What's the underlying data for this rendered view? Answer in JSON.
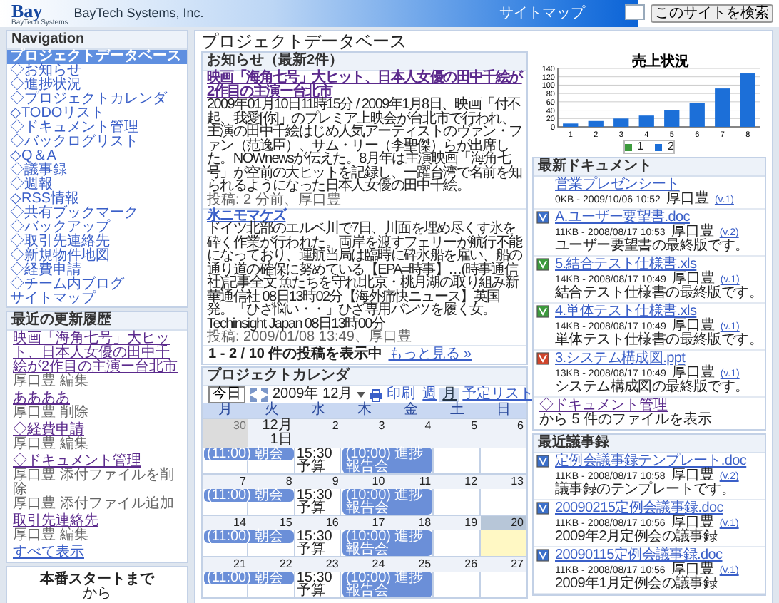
{
  "header": {
    "logo": "Bay",
    "logo_subtitle": "BayTech Systems",
    "company": "BayTech Systems, Inc.",
    "sitemap_link": "サイトマップ",
    "search_button": "このサイトを検索"
  },
  "page_title": "プロジェクトデータベース",
  "sidebar": {
    "navigation": {
      "title": "Navigation",
      "items": [
        {
          "label": "プロジェクトデータベース",
          "selected": true
        },
        {
          "label": "◇お知らせ",
          "selected": false
        },
        {
          "label": "◇進捗状況",
          "selected": false
        },
        {
          "label": "◇プロジェクトカレンダ",
          "selected": false
        },
        {
          "label": "◇TODOリスト",
          "selected": false
        },
        {
          "label": "◇ドキュメント管理",
          "selected": false
        },
        {
          "label": "◇バックログリスト",
          "selected": false
        },
        {
          "label": "◇Q＆A",
          "selected": false
        },
        {
          "label": "◇議事録",
          "selected": false
        },
        {
          "label": "◇週報",
          "selected": false
        },
        {
          "label": "◇RSS情報",
          "selected": false
        },
        {
          "label": "◇共有ブックマーク",
          "selected": false
        },
        {
          "label": "◇バックアップ",
          "selected": false
        },
        {
          "label": "◇取引先連絡先",
          "selected": false
        },
        {
          "label": "◇新規物件地図",
          "selected": false
        },
        {
          "label": "◇経費申請",
          "selected": false
        },
        {
          "label": "◇チーム内ブログ",
          "selected": false
        },
        {
          "label": "サイトマップ",
          "selected": false
        }
      ]
    },
    "recent_updates": {
      "title": "最近の更新履歴",
      "entries": [
        {
          "link": "映画「海角七号」大ヒット、日本人女優の田中千絵が2作目の主演ー台北市",
          "lines": [
            "厚口豊 編集"
          ]
        },
        {
          "link": "ああああ",
          "lines": [
            "厚口豊 削除"
          ]
        },
        {
          "link": "◇経費申請",
          "lines": [
            "厚口豊 編集"
          ]
        },
        {
          "link": "◇ドキュメント管理",
          "lines": [
            "厚口豊 添付ファイルを削除",
            "厚口豊 添付ファイル追加"
          ]
        },
        {
          "link": "取引先連絡先",
          "lines": [
            "厚口豊 編集"
          ]
        }
      ],
      "show_all": "すべて表示"
    },
    "countdown": {
      "title": "本番スタートまで",
      "text": "から"
    }
  },
  "news": {
    "title": "お知らせ（最新2件）",
    "items": [
      {
        "title": "映画「海角七号」大ヒット、日本人女優の田中千絵が2作目の主演ー台北市",
        "body": "2009年01月10日11時15分 / 2009年1月8日、映画「付不起、我愛[你]」のプレミア上映会が台北市で行われ、主演の田中千絵はじめ人気アーティストのヴァン・ファン（范逸臣）、サム・リー（李聖傑）らが出席した。NOWnewsが伝えた。8月年は主演映画「海角七号」が空前の大ヒットを記録し、一躍台湾で名前を知られるようになった日本人女優の田中千絵。",
        "meta": "投稿: 2 分前、厚口豊"
      },
      {
        "title": "氷ニモマケズ",
        "body": "ドイツ北部のエルベ川で7日、川面を埋め尽くす氷を砕く作業が行われた。両岸を渡すフェリーが航行不能になっており、運航当局は臨時に砕氷船を雇い、船の通り道の確保に努めている【EPA=時事】…(時事通信社)記事全文 魚たちを守れ!北京・桃月湖の取り組み新華通信社 08日13時02分【海外痛快ニュース】英国発。「ひざ悩い・・」ひざ専用パンツを履く女。 Techinsight Japan 08日13時00分",
        "meta": "投稿: 2009/01/08 13:49、厚口豊"
      }
    ],
    "footer": "1 - 2 / 10 件の投稿を表示中",
    "more_link": "もっと見る »"
  },
  "calendar": {
    "title": "プロジェクトカレンダ",
    "today_button": "今日",
    "month": "2009年 12月",
    "print": "印刷",
    "views": [
      {
        "label": "週",
        "selected": false
      },
      {
        "label": "月",
        "selected": true
      },
      {
        "label": "予定リスト",
        "selected": false
      }
    ],
    "weekdays": [
      "月",
      "火",
      "水",
      "木",
      "金",
      "土",
      "日"
    ],
    "weeks": [
      {
        "days": [
          {
            "label": "30",
            "other_month": true,
            "today": false
          },
          {
            "label": "12月 1日",
            "other_month": false,
            "today": false
          },
          {
            "label": "2",
            "other_month": false,
            "today": false
          },
          {
            "label": "3",
            "other_month": false,
            "today": false
          },
          {
            "label": "4",
            "other_month": false,
            "today": false
          },
          {
            "label": "5",
            "other_month": false,
            "today": false
          },
          {
            "label": "6",
            "other_month": false,
            "today": false
          }
        ],
        "events": [
          {
            "kind": "bar",
            "text": "(11:00) 朝会"
          },
          {
            "kind": "timed",
            "text": "15:30 予算"
          },
          {
            "kind": "bar",
            "text": "(10:00) 進捗報告会"
          }
        ]
      },
      {
        "days": [
          {
            "label": "7",
            "other_month": false,
            "today": false
          },
          {
            "label": "8",
            "other_month": false,
            "today": false
          },
          {
            "label": "9",
            "other_month": false,
            "today": false
          },
          {
            "label": "10",
            "other_month": false,
            "today": false
          },
          {
            "label": "11",
            "other_month": false,
            "today": false
          },
          {
            "label": "12",
            "other_month": false,
            "today": false
          },
          {
            "label": "13",
            "other_month": false,
            "today": false
          }
        ],
        "events": [
          {
            "kind": "bar",
            "text": "(11:00) 朝会"
          },
          {
            "kind": "timed",
            "text": "15:30 予算"
          },
          {
            "kind": "bar",
            "text": "(10:00) 進捗報告会"
          }
        ]
      },
      {
        "days": [
          {
            "label": "14",
            "other_month": false,
            "today": false
          },
          {
            "label": "15",
            "other_month": false,
            "today": false
          },
          {
            "label": "16",
            "other_month": false,
            "today": false
          },
          {
            "label": "17",
            "other_month": false,
            "today": false
          },
          {
            "label": "18",
            "other_month": false,
            "today": false
          },
          {
            "label": "19",
            "other_month": false,
            "today": false
          },
          {
            "label": "20",
            "other_month": false,
            "today": true
          }
        ],
        "events": [
          {
            "kind": "bar",
            "text": "(11:00) 朝会"
          },
          {
            "kind": "timed",
            "text": "15:30 予算"
          },
          {
            "kind": "bar",
            "text": "(10:00) 進捗報告会"
          }
        ]
      },
      {
        "days": [
          {
            "label": "21",
            "other_month": false,
            "today": false
          },
          {
            "label": "22",
            "other_month": false,
            "today": false
          },
          {
            "label": "23",
            "other_month": false,
            "today": false
          },
          {
            "label": "24",
            "other_month": false,
            "today": false
          },
          {
            "label": "25",
            "other_month": false,
            "today": false
          },
          {
            "label": "26",
            "other_month": false,
            "today": false
          },
          {
            "label": "27",
            "other_month": false,
            "today": false
          }
        ],
        "events": [
          {
            "kind": "bar",
            "text": "(11:00) 朝会"
          },
          {
            "kind": "timed",
            "text": "15:30 予算"
          },
          {
            "kind": "bar",
            "text": "(10:00) 進捗報告会"
          }
        ]
      }
    ]
  },
  "sales": {
    "chart_data": {
      "type": "bar",
      "title": "売上状況",
      "categories": [
        "1",
        "2",
        "3",
        "4",
        "5",
        "6",
        "7",
        "8"
      ],
      "ylim": [
        0,
        140
      ],
      "yticks": [
        0,
        20,
        40,
        60,
        80,
        100,
        120,
        140
      ],
      "grid": true,
      "series": [
        {
          "name": "1",
          "color": "#3c9a3c",
          "values": [
            null,
            null,
            null,
            null,
            null,
            null,
            null,
            null
          ]
        },
        {
          "name": "2",
          "color": "#1c6fd8",
          "values": [
            8,
            14,
            20,
            27,
            40,
            57,
            92,
            128
          ]
        }
      ]
    }
  },
  "recent_documents": {
    "title": "最新ドキュメント",
    "items": [
      {
        "kind": "plain",
        "name": "営業プレゼンシート",
        "size_date": "0KB - 2009/10/06 10:52",
        "author": "厚口豊",
        "version": "(v.1)"
      },
      {
        "kind": "doc",
        "name": "A.ユーザー要望書.doc",
        "size_date": "11KB - 2008/08/17 10:53",
        "author": "厚口豊",
        "version": "(v.2)",
        "description": "ユーザー要望書の最終版です。"
      },
      {
        "kind": "xls",
        "name": "5.結合テスト仕様書.xls",
        "size_date": "14KB - 2008/08/17 10:49",
        "author": "厚口豊",
        "version": "(v.1)",
        "description": "結合テスト仕様書の最終版です。"
      },
      {
        "kind": "xls",
        "name": "4.単体テスト仕様書.xls",
        "size_date": "14KB - 2008/08/17 10:49",
        "author": "厚口豊",
        "version": "(v.1)",
        "description": "単体テスト仕様書の最終版です。"
      },
      {
        "kind": "ppt",
        "name": "3.システム構成図.ppt",
        "size_date": "13KB - 2008/08/17 10:49",
        "author": "厚口豊",
        "version": "(v.1)",
        "description": "システム構成図の最終版です。"
      }
    ],
    "footer_link": "◇ドキュメント管理",
    "footer_text": "から 5 件のファイルを表示"
  },
  "recent_minutes": {
    "title": "最近議事録",
    "items": [
      {
        "kind": "doc",
        "name": "定例会議事録テンプレート.doc",
        "size_date": "11KB - 2008/08/17 10:58",
        "author": "厚口豊",
        "version": "(v.2)",
        "description": "議事録のテンプレートです。"
      },
      {
        "kind": "doc",
        "name": "20090215定例会議事録.doc",
        "size_date": "11KB - 2008/08/17 10:56",
        "author": "厚口豊",
        "version": "(v.1)",
        "description": "2009年2月定例会の議事録"
      },
      {
        "kind": "doc",
        "name": "20090115定例会議事録.doc",
        "size_date": "11KB - 2008/08/17 10:56",
        "author": "厚口豊",
        "version": "(v.1)",
        "description": "2009年1月定例会の議事録"
      }
    ]
  }
}
